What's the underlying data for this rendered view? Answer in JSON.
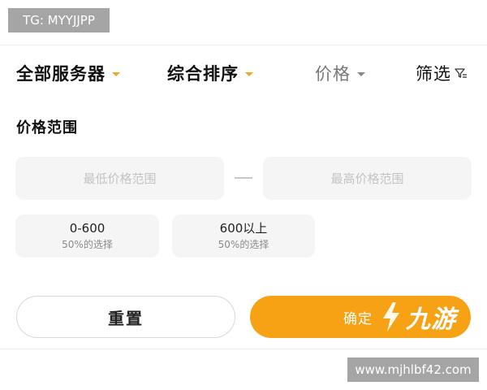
{
  "watermark": {
    "tg": "TG: MYYJJPP",
    "url": "www.mjhlbf42.com",
    "logo": "九游"
  },
  "filter_bar": {
    "servers_label": "全部服务器",
    "sort_label": "综合排序",
    "price_label": "价格",
    "filter_label": "筛选"
  },
  "price_section": {
    "title": "价格范围",
    "min_placeholder": "最低价格范围",
    "max_placeholder": "最高价格范围",
    "chips": [
      {
        "range": "0-600",
        "share": "50%的选择"
      },
      {
        "range": "600以上",
        "share": "50%的选择"
      }
    ]
  },
  "actions": {
    "reset_label": "重置",
    "confirm_label": "确定"
  },
  "colors": {
    "accent": "#f7a215",
    "caret_active": "#f5a623",
    "chip_bg": "#f5f5f5"
  }
}
